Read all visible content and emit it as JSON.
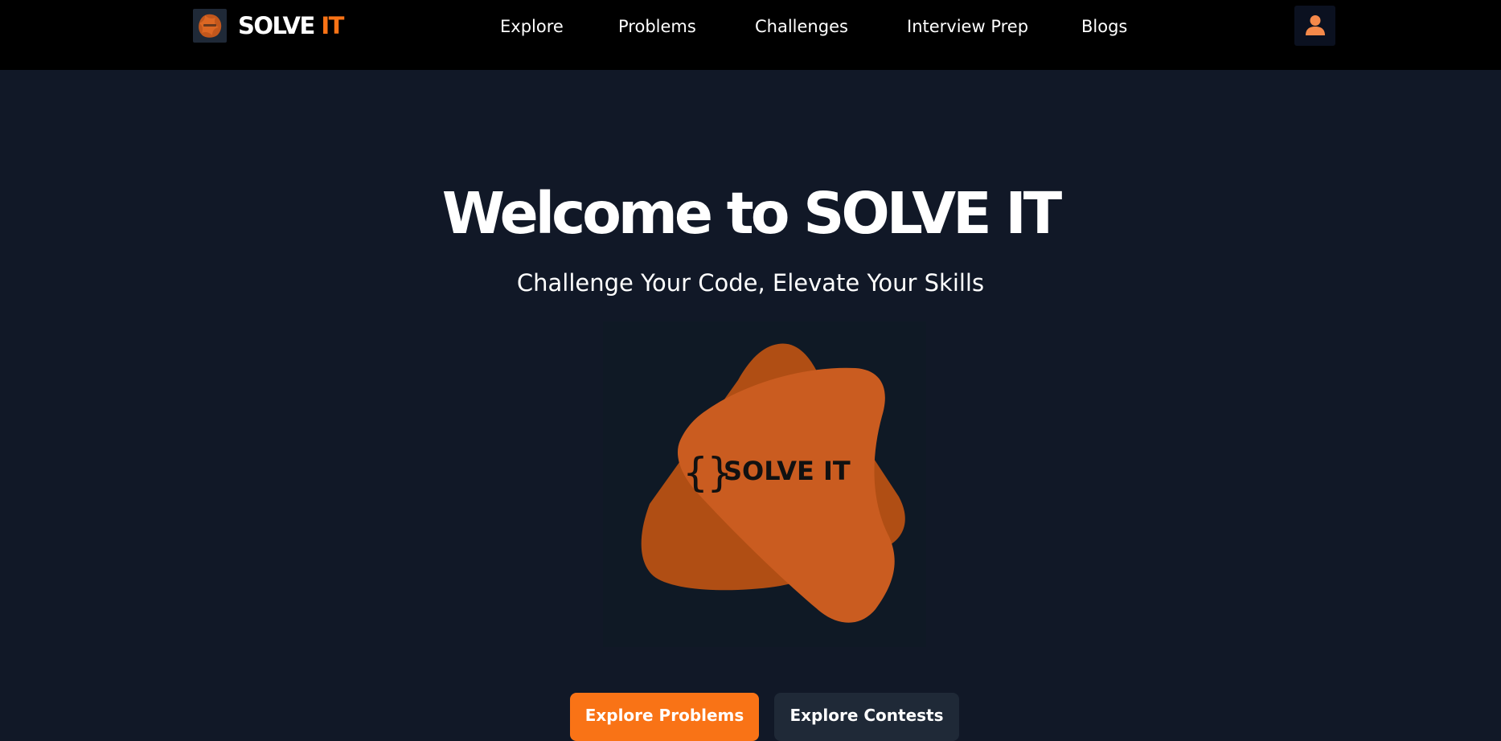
{
  "brand": {
    "name_main": "SOLVE ",
    "name_accent": "IT",
    "logo_icon": "solve-it-logo",
    "accent_color": "#f97316"
  },
  "nav": {
    "items": [
      {
        "label": "Explore"
      },
      {
        "label": "Problems"
      },
      {
        "label": "Challenges"
      },
      {
        "label": "Interview Prep"
      },
      {
        "label": "Blogs"
      }
    ],
    "profile_icon": "user-icon"
  },
  "hero": {
    "title": "Welcome to SOLVE IT",
    "subtitle": "Challenge Your Code, Elevate Your Skills",
    "logo_braces": "{}",
    "logo_text": "SOLVE IT"
  },
  "actions": {
    "primary_label": "Explore Problems",
    "secondary_label": "Explore Contests"
  },
  "colors": {
    "page_background": "#111827",
    "navbar_background": "#000000",
    "primary_button": "#f97316",
    "secondary_button": "#1f2937",
    "blob_back": "#b04e14",
    "blob_front": "#ca5c20"
  }
}
